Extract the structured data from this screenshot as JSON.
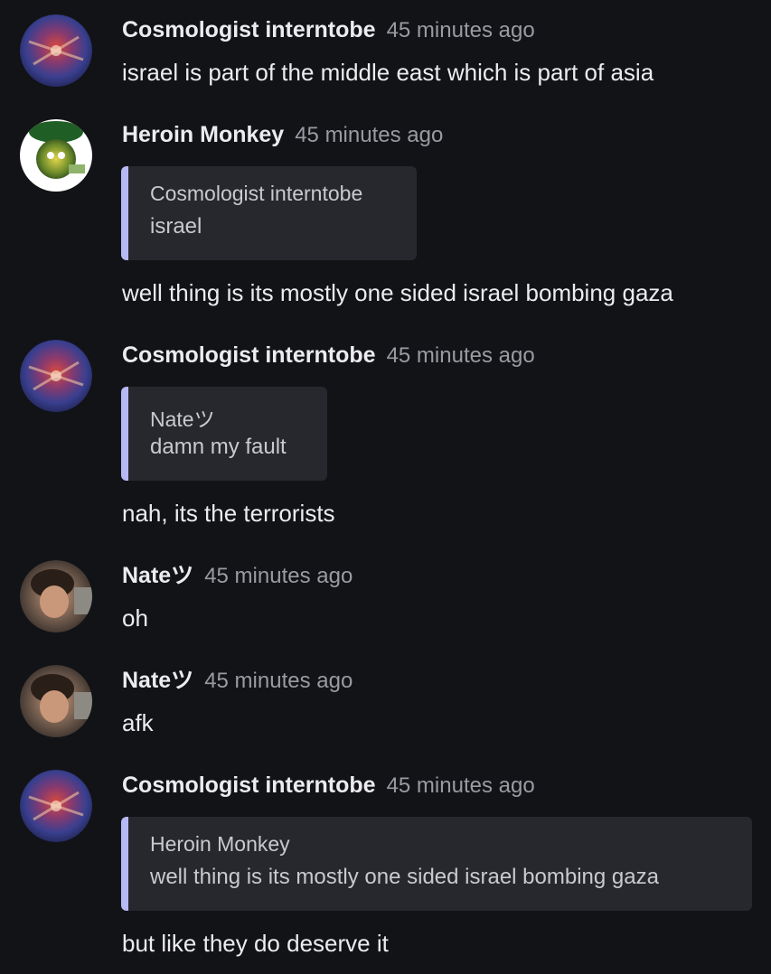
{
  "messages": [
    {
      "author": "Cosmologist interntobe",
      "time": "45 minutes ago",
      "avatar": "galaxy-avatar",
      "text": "israel is part of the middle east which is part of asia"
    },
    {
      "author": "Heroin Monkey",
      "time": "45 minutes ago",
      "avatar": "spongebob-avatar",
      "quote": {
        "author": "Cosmologist interntobe",
        "text": "israel"
      },
      "text": "well thing is its mostly one sided israel bombing gaza"
    },
    {
      "author": "Cosmologist interntobe",
      "time": "45 minutes ago",
      "avatar": "galaxy-avatar",
      "quote": {
        "author": "Nateツ",
        "text": "damn my fault"
      },
      "text": "nah, its the terrorists"
    },
    {
      "author": "Nateツ",
      "time": "45 minutes ago",
      "avatar": "person-avatar",
      "text": "oh"
    },
    {
      "author": "Nateツ",
      "time": "45 minutes ago",
      "avatar": "person-avatar",
      "text": "afk"
    },
    {
      "author": "Cosmologist interntobe",
      "time": "45 minutes ago",
      "avatar": "galaxy-avatar",
      "quote": {
        "author": "Heroin Monkey",
        "text": "well thing is its mostly one sided israel bombing gaza"
      },
      "text": "but like they do deserve it"
    }
  ],
  "colors": {
    "background": "#121317",
    "quote_background": "#27282d",
    "quote_accent": "#b6b9f3",
    "timestamp": "#9a9ba2"
  }
}
